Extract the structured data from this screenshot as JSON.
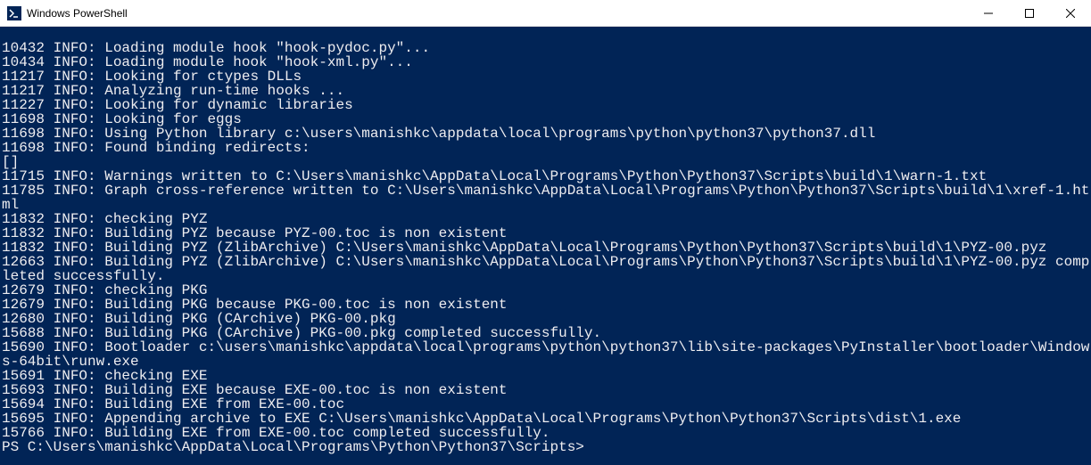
{
  "window": {
    "title": "Windows PowerShell",
    "icon_bg": "#012456",
    "icon_fg": "#ffffff"
  },
  "terminal": {
    "lines": [
      "10432 INFO: Loading module hook \"hook-pydoc.py\"...",
      "10434 INFO: Loading module hook \"hook-xml.py\"...",
      "11217 INFO: Looking for ctypes DLLs",
      "11217 INFO: Analyzing run-time hooks ...",
      "11227 INFO: Looking for dynamic libraries",
      "11698 INFO: Looking for eggs",
      "11698 INFO: Using Python library c:\\users\\manishkc\\appdata\\local\\programs\\python\\python37\\python37.dll",
      "11698 INFO: Found binding redirects:",
      "[]",
      "11715 INFO: Warnings written to C:\\Users\\manishkc\\AppData\\Local\\Programs\\Python\\Python37\\Scripts\\build\\1\\warn-1.txt",
      "11785 INFO: Graph cross-reference written to C:\\Users\\manishkc\\AppData\\Local\\Programs\\Python\\Python37\\Scripts\\build\\1\\xref-1.html",
      "11832 INFO: checking PYZ",
      "11832 INFO: Building PYZ because PYZ-00.toc is non existent",
      "11832 INFO: Building PYZ (ZlibArchive) C:\\Users\\manishkc\\AppData\\Local\\Programs\\Python\\Python37\\Scripts\\build\\1\\PYZ-00.pyz",
      "12663 INFO: Building PYZ (ZlibArchive) C:\\Users\\manishkc\\AppData\\Local\\Programs\\Python\\Python37\\Scripts\\build\\1\\PYZ-00.pyz completed successfully.",
      "12679 INFO: checking PKG",
      "12679 INFO: Building PKG because PKG-00.toc is non existent",
      "12680 INFO: Building PKG (CArchive) PKG-00.pkg",
      "15688 INFO: Building PKG (CArchive) PKG-00.pkg completed successfully.",
      "15690 INFO: Bootloader c:\\users\\manishkc\\appdata\\local\\programs\\python\\python37\\lib\\site-packages\\PyInstaller\\bootloader\\Windows-64bit\\runw.exe",
      "15691 INFO: checking EXE",
      "15693 INFO: Building EXE because EXE-00.toc is non existent",
      "15694 INFO: Building EXE from EXE-00.toc",
      "15695 INFO: Appending archive to EXE C:\\Users\\manishkc\\AppData\\Local\\Programs\\Python\\Python37\\Scripts\\dist\\1.exe",
      "15766 INFO: Building EXE from EXE-00.toc completed successfully."
    ],
    "prompt": "PS C:\\Users\\manishkc\\AppData\\Local\\Programs\\Python\\Python37\\Scripts>"
  }
}
